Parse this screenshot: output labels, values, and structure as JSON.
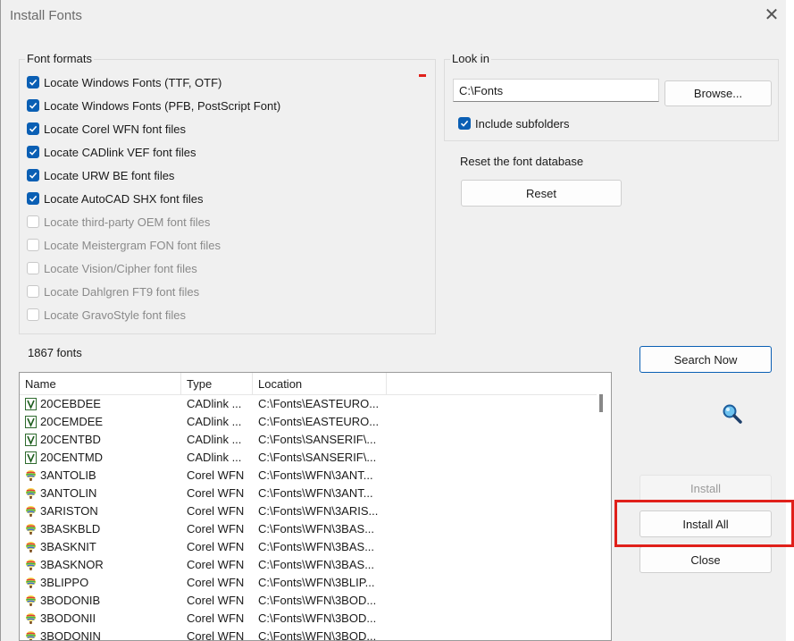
{
  "title": "Install Fonts",
  "font_formats": {
    "legend": "Font formats",
    "items": [
      {
        "label": "Locate Windows Fonts (TTF, OTF)",
        "checked": true,
        "enabled": true
      },
      {
        "label": "Locate Windows Fonts (PFB, PostScript Font)",
        "checked": true,
        "enabled": true
      },
      {
        "label": "Locate Corel WFN font files",
        "checked": true,
        "enabled": true
      },
      {
        "label": "Locate CADlink VEF font files",
        "checked": true,
        "enabled": true
      },
      {
        "label": "Locate URW BE font files",
        "checked": true,
        "enabled": true
      },
      {
        "label": "Locate AutoCAD SHX font files",
        "checked": true,
        "enabled": true
      },
      {
        "label": "Locate third-party OEM font files",
        "checked": false,
        "enabled": false
      },
      {
        "label": "Locate Meistergram FON font files",
        "checked": false,
        "enabled": false
      },
      {
        "label": "Locate Vision/Cipher font files",
        "checked": false,
        "enabled": false
      },
      {
        "label": "Locate Dahlgren FT9 font files",
        "checked": false,
        "enabled": false
      },
      {
        "label": "Locate GravoStyle font files",
        "checked": false,
        "enabled": false
      }
    ]
  },
  "look_in": {
    "legend": "Look in",
    "path": "C:\\Fonts",
    "browse_label": "Browse...",
    "include_subfolders_label": "Include subfolders",
    "include_subfolders_checked": true
  },
  "reset": {
    "heading": "Reset the font database",
    "button_label": "Reset"
  },
  "font_count": "1867 fonts",
  "buttons": {
    "search_now": "Search Now",
    "install": "Install",
    "install_all": "Install All",
    "close": "Close"
  },
  "table": {
    "columns": [
      "Name",
      "Type",
      "Location"
    ],
    "rows": [
      {
        "name": "20CEBDEE",
        "type": "CADlink ...",
        "location": "C:\\Fonts\\EASTEURO...",
        "icon": "cadlink-vef-icon"
      },
      {
        "name": "20CEMDEE",
        "type": "CADlink ...",
        "location": "C:\\Fonts\\EASTEURO...",
        "icon": "cadlink-vef-icon"
      },
      {
        "name": "20CENTBD",
        "type": "CADlink ...",
        "location": "C:\\Fonts\\SANSERIF\\...",
        "icon": "cadlink-vef-icon"
      },
      {
        "name": "20CENTMD",
        "type": "CADlink ...",
        "location": "C:\\Fonts\\SANSERIF\\...",
        "icon": "cadlink-vef-icon"
      },
      {
        "name": "3ANTOLIB",
        "type": "Corel WFN",
        "location": "C:\\Fonts\\WFN\\3ANT...",
        "icon": "corel-wfn-icon"
      },
      {
        "name": "3ANTOLIN",
        "type": "Corel WFN",
        "location": "C:\\Fonts\\WFN\\3ANT...",
        "icon": "corel-wfn-icon"
      },
      {
        "name": "3ARISTON",
        "type": "Corel WFN",
        "location": "C:\\Fonts\\WFN\\3ARIS...",
        "icon": "corel-wfn-icon"
      },
      {
        "name": "3BASKBLD",
        "type": "Corel WFN",
        "location": "C:\\Fonts\\WFN\\3BAS...",
        "icon": "corel-wfn-icon"
      },
      {
        "name": "3BASKNIT",
        "type": "Corel WFN",
        "location": "C:\\Fonts\\WFN\\3BAS...",
        "icon": "corel-wfn-icon"
      },
      {
        "name": "3BASKNOR",
        "type": "Corel WFN",
        "location": "C:\\Fonts\\WFN\\3BAS...",
        "icon": "corel-wfn-icon"
      },
      {
        "name": "3BLIPPO",
        "type": "Corel WFN",
        "location": "C:\\Fonts\\WFN\\3BLIP...",
        "icon": "corel-wfn-icon"
      },
      {
        "name": "3BODONIB",
        "type": "Corel WFN",
        "location": "C:\\Fonts\\WFN\\3BOD...",
        "icon": "corel-wfn-icon"
      },
      {
        "name": "3BODONII",
        "type": "Corel WFN",
        "location": "C:\\Fonts\\WFN\\3BOD...",
        "icon": "corel-wfn-icon"
      },
      {
        "name": "3BODONIN",
        "type": "Corel WFN",
        "location": "C:\\Fonts\\WFN\\3BOD...",
        "icon": "corel-wfn-icon"
      }
    ]
  },
  "colors": {
    "accent": "#0a5fb4",
    "highlight_box": "#e0201a"
  }
}
